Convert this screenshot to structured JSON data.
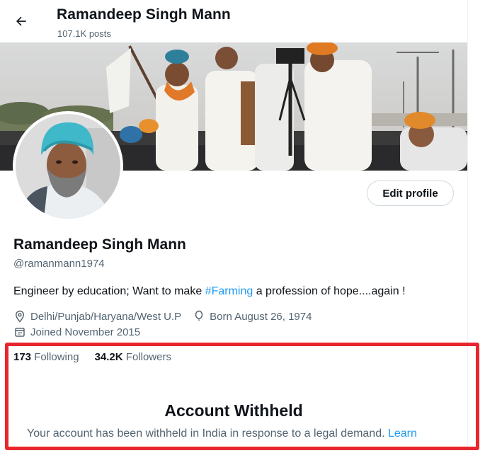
{
  "header": {
    "back_icon": "arrow-left-icon",
    "title": "Ramandeep Singh Mann",
    "posts_count": "107.1K posts"
  },
  "profile": {
    "edit_button": "Edit profile",
    "display_name": "Ramandeep Singh Mann",
    "handle": "@ramanmann1974",
    "bio_prefix": "Engineer by education; Want to make ",
    "bio_hashtag": "#Farming",
    "bio_suffix": " a profession of hope....again !",
    "location_icon": "location-pin-icon",
    "location": "Delhi/Punjab/Haryana/West U.P",
    "birthday_icon": "balloon-icon",
    "birthday": "Born August 26, 1974",
    "joined_icon": "calendar-icon",
    "joined": "Joined November 2015"
  },
  "stats": {
    "following_count": "173",
    "following_label": "Following",
    "followers_count": "34.2K",
    "followers_label": "Followers"
  },
  "withheld": {
    "title": "Account Withheld",
    "message": "Your account has been withheld in India in response to a legal demand. ",
    "learn_link": "Learn"
  },
  "colors": {
    "accent": "#1d9bf0",
    "highlight_box": "#e8262e",
    "secondary_text": "#536471"
  }
}
